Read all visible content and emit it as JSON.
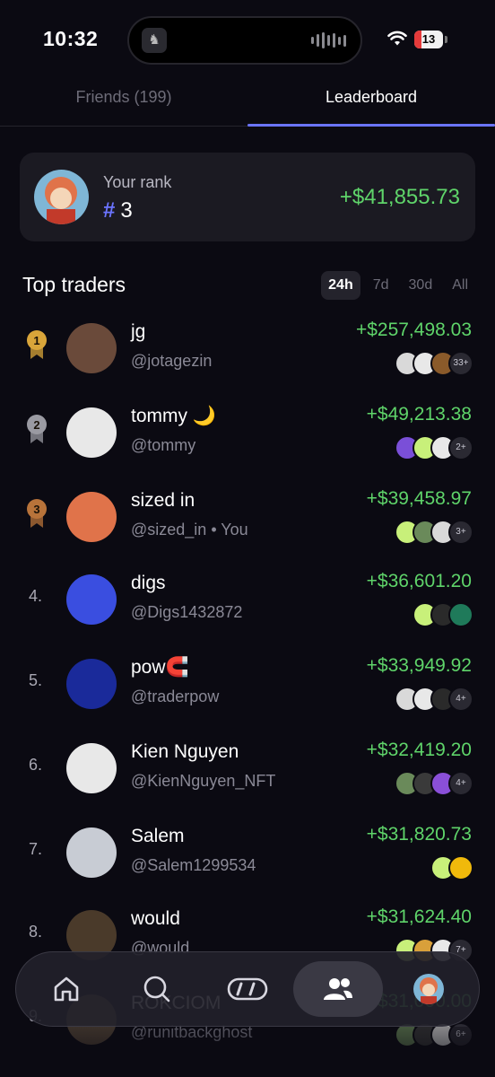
{
  "status_bar": {
    "time": "10:32",
    "battery": "13"
  },
  "tabs": [
    {
      "label": "Friends (199)",
      "active": false
    },
    {
      "label": "Leaderboard",
      "active": true
    }
  ],
  "your_rank": {
    "label": "Your rank",
    "hash": "#",
    "rank": "3",
    "pnl": "+$41,855.73"
  },
  "top_traders": {
    "title": "Top traders",
    "filters": [
      "24h",
      "7d",
      "30d",
      "All"
    ],
    "active_filter": "24h"
  },
  "traders": [
    {
      "rank": "1",
      "medal": "gold",
      "name": "jg",
      "handle": "@jotagezin",
      "pnl": "+$257,498.03",
      "more": "33+",
      "coins": [
        "#d9d9d9",
        "#e8e8e8",
        "#8a5a2a"
      ],
      "avatar": "#6a4a3a"
    },
    {
      "rank": "2",
      "medal": "silver",
      "name": "tommy 🌙",
      "handle": "@tommy",
      "pnl": "+$49,213.38",
      "more": "2+",
      "coins": [
        "#7a4fd8",
        "#c8f07a",
        "#e8e8e8"
      ],
      "avatar": "#e8e8e8"
    },
    {
      "rank": "3",
      "medal": "bronze",
      "name": "sized in",
      "handle": "@sized_in • You",
      "pnl": "+$39,458.97",
      "more": "3+",
      "coins": [
        "#c8f07a",
        "#6a8a5a",
        "#d9d9d9"
      ],
      "avatar": "#e0734a"
    },
    {
      "rank": "4.",
      "medal": "",
      "name": "digs",
      "handle": "@Digs1432872",
      "pnl": "+$36,601.20",
      "more": "",
      "coins": [
        "#c8f07a",
        "#2a2a2a",
        "#1f7a5a"
      ],
      "avatar": "#3a4ee0"
    },
    {
      "rank": "5.",
      "medal": "",
      "name": "pow🧲",
      "handle": "@traderpow",
      "pnl": "+$33,949.92",
      "more": "4+",
      "coins": [
        "#d9d9d9",
        "#e8e8e8",
        "#2a2a2a"
      ],
      "avatar": "#1a2a9a"
    },
    {
      "rank": "6.",
      "medal": "",
      "name": "Kien Nguyen",
      "handle": "@KienNguyen_NFT",
      "pnl": "+$32,419.20",
      "more": "4+",
      "coins": [
        "#6a8a5a",
        "#3a3a3a",
        "#8a4fd8"
      ],
      "avatar": "#e8e8e8"
    },
    {
      "rank": "7.",
      "medal": "",
      "name": "Salem",
      "handle": "@Salem1299534",
      "pnl": "+$31,820.73",
      "more": "",
      "coins": [
        "#c8f07a",
        "#f0b90b"
      ],
      "avatar": "#c8ccd4"
    },
    {
      "rank": "8.",
      "medal": "",
      "name": "would",
      "handle": "@would",
      "pnl": "+$31,624.40",
      "more": "7+",
      "coins": [
        "#c8f07a",
        "#d9a03a",
        "#e8e8e8"
      ],
      "avatar": "#4a3a2a"
    },
    {
      "rank": "9.",
      "medal": "",
      "name": "ROKCIOM",
      "handle": "@runitbackghost",
      "pnl": "+$31,000.00",
      "more": "6+",
      "coins": [
        "#6a8a5a",
        "#3a3a3a",
        "#d9d9d9"
      ],
      "avatar": "#5a4a3a"
    }
  ],
  "bottom_nav": [
    {
      "icon": "home-icon",
      "active": false
    },
    {
      "icon": "search-icon",
      "active": false
    },
    {
      "icon": "trade-icon",
      "active": false
    },
    {
      "icon": "friends-icon",
      "active": true
    },
    {
      "icon": "profile-avatar",
      "active": false
    }
  ],
  "colors": {
    "accent": "#6b74ff",
    "positive": "#5fd46a",
    "background": "#0b0a12"
  }
}
